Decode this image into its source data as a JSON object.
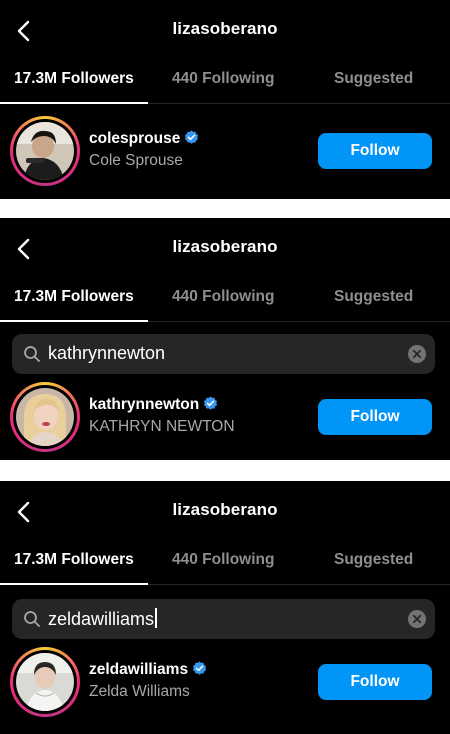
{
  "colors": {
    "background": "#000000",
    "divider": "#262626",
    "muted": "#8e8e8e",
    "follow_blue": "#0095f6",
    "verified_blue": "#3897f0"
  },
  "icons": {
    "back": "chevron-left-icon",
    "search": "magnifier-icon",
    "clear": "clear-x-icon",
    "verified": "verified-badge-icon"
  },
  "screens": [
    {
      "title": "lizasoberano",
      "tabs": [
        "17.3M Followers",
        "440 Following",
        "Suggested"
      ],
      "active_tab": 0,
      "search": null,
      "result": {
        "username": "colesprouse",
        "fullname": "Cole Sprouse",
        "verified": true,
        "button": "Follow"
      }
    },
    {
      "title": "lizasoberano",
      "tabs": [
        "17.3M Followers",
        "440 Following",
        "Suggested"
      ],
      "active_tab": 0,
      "search": {
        "value": "kathrynnewton"
      },
      "result": {
        "username": "kathrynnewton",
        "fullname": "KATHRYN NEWTON",
        "verified": true,
        "button": "Follow"
      }
    },
    {
      "title": "lizasoberano",
      "tabs": [
        "17.3M Followers",
        "440 Following",
        "Suggested"
      ],
      "active_tab": 0,
      "search": {
        "value": "zeldawilliams"
      },
      "result": {
        "username": "zeldawilliams",
        "fullname": "Zelda Williams",
        "verified": true,
        "button": "Follow"
      }
    }
  ]
}
